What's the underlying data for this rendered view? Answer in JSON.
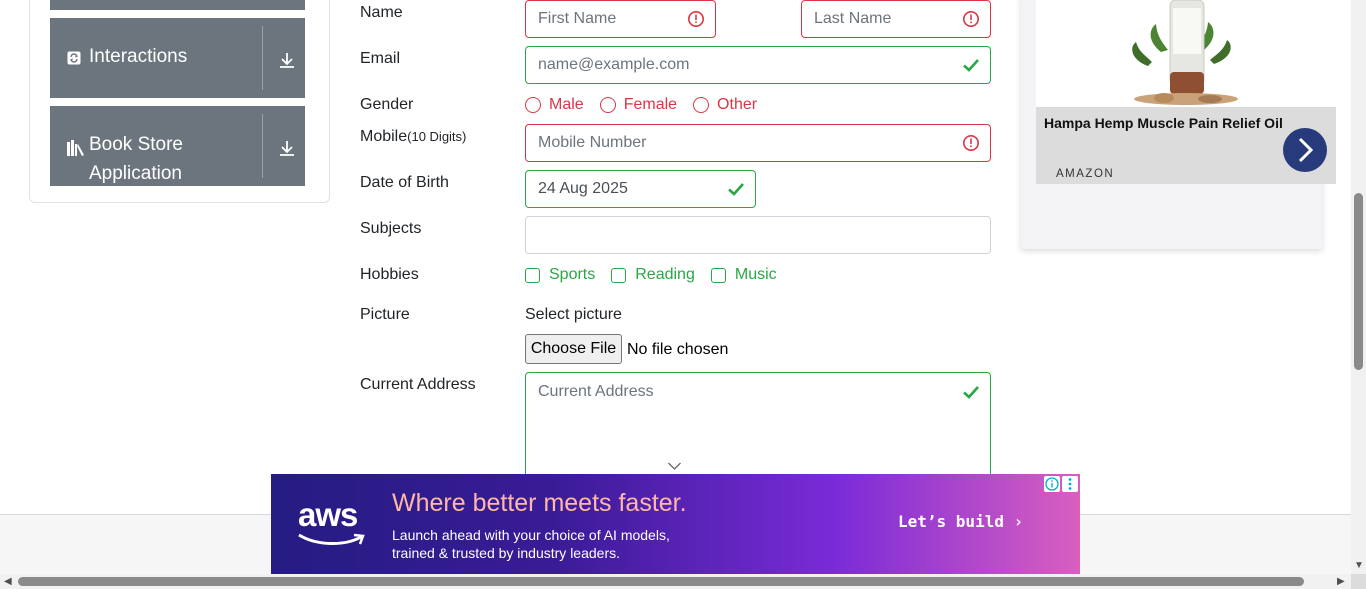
{
  "sidebar": {
    "items": [
      {
        "label": "Interactions",
        "icon": "refresh-icon"
      },
      {
        "label": "Book Store Application",
        "icon": "books-icon"
      }
    ]
  },
  "form": {
    "name": {
      "label": "Name",
      "first_placeholder": "First Name",
      "last_placeholder": "Last Name"
    },
    "email": {
      "label": "Email",
      "placeholder": "name@example.com"
    },
    "gender": {
      "label": "Gender",
      "options": [
        "Male",
        "Female",
        "Other"
      ]
    },
    "mobile": {
      "label": "Mobile",
      "hint": "(10 Digits)",
      "placeholder": "Mobile Number"
    },
    "dob": {
      "label": "Date of Birth",
      "value": "24 Aug 2025"
    },
    "subjects": {
      "label": "Subjects",
      "value": ""
    },
    "hobbies": {
      "label": "Hobbies",
      "options": [
        "Sports",
        "Reading",
        "Music"
      ]
    },
    "picture": {
      "label": "Picture",
      "select_text": "Select picture",
      "button_label": "Choose File",
      "file_status": "No file chosen"
    },
    "address": {
      "label": "Current Address",
      "placeholder": "Current Address"
    }
  },
  "right_ad": {
    "title": "Hampa Hemp Muscle Pain Relief Oil",
    "source": "AMAZON"
  },
  "bottom_ad": {
    "logo": "aws",
    "headline": "Where better meets faster.",
    "sub1": "Launch ahead with your choice of AI models,",
    "sub2": "trained & trusted by industry leaders.",
    "cta": "Let’s build ›"
  },
  "colors": {
    "invalid": "#dc3545",
    "valid": "#28a745",
    "sidebar": "#6c757d",
    "ad_arrow": "#273a7b"
  }
}
